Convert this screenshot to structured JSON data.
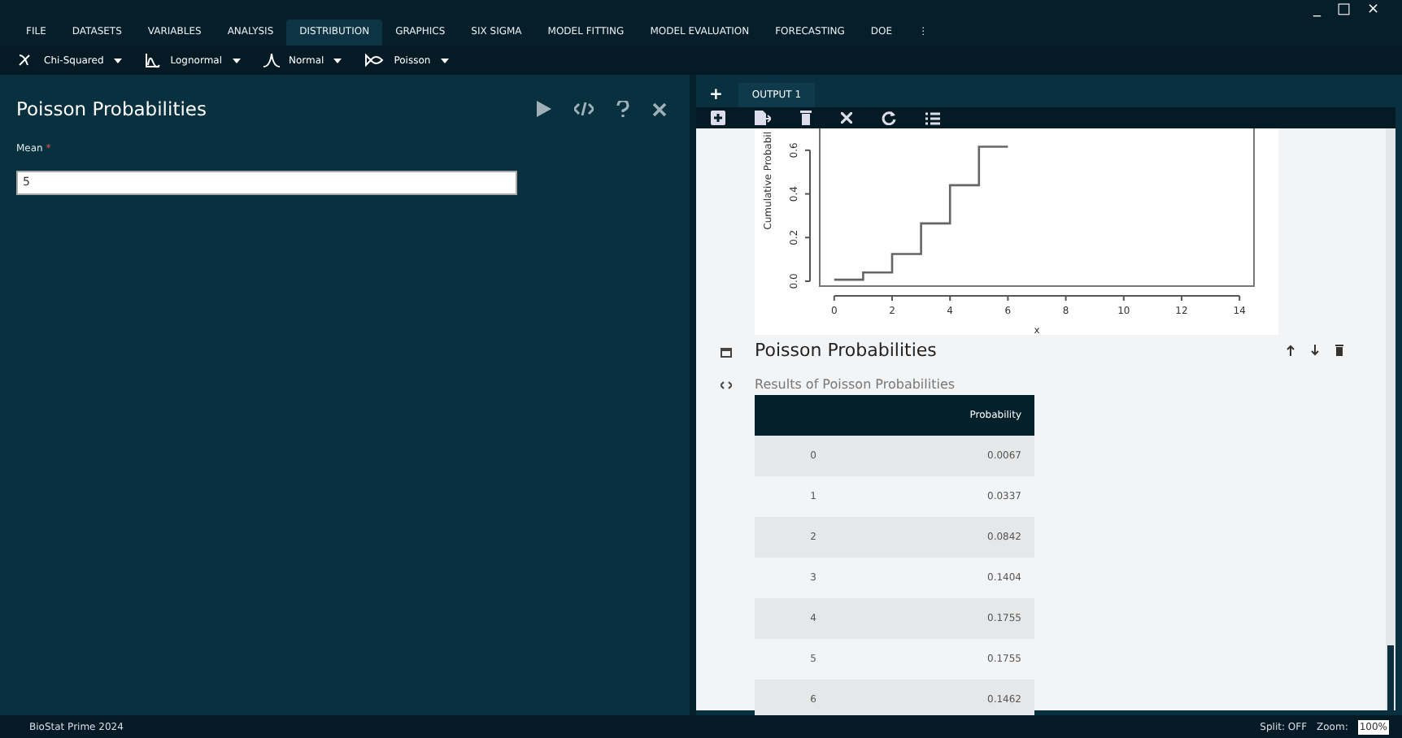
{
  "window_controls": [
    "_",
    "□",
    "×"
  ],
  "menu": [
    {
      "label": "FILE",
      "selected": false
    },
    {
      "label": "DATASETS",
      "selected": false
    },
    {
      "label": "VARIABLES",
      "selected": false
    },
    {
      "label": "ANALYSIS",
      "selected": false
    },
    {
      "label": "DISTRIBUTION",
      "selected": true
    },
    {
      "label": "GRAPHICS",
      "selected": false
    },
    {
      "label": "SIX SIGMA",
      "selected": false
    },
    {
      "label": "MODEL FITTING",
      "selected": false
    },
    {
      "label": "MODEL EVALUATION",
      "selected": false
    },
    {
      "label": "FORECASTING",
      "selected": false
    },
    {
      "label": "DOE",
      "selected": false
    },
    {
      "label": "⋮",
      "selected": false
    }
  ],
  "toolbar": [
    {
      "label": "Chi-Squared",
      "kind": "chi"
    },
    {
      "label": "Lognormal",
      "kind": "lognormal"
    },
    {
      "label": "Normal",
      "kind": "normal"
    },
    {
      "label": "Poisson",
      "kind": "poisson"
    }
  ],
  "left_panel": {
    "title": "Poisson Probabilities",
    "field": {
      "label": "Mean",
      "required_mark": "*",
      "value": "5"
    }
  },
  "output": {
    "add": "+",
    "tabs": [
      {
        "label": "OUTPUT 1",
        "selected": true
      }
    ],
    "chart_data": {
      "type": "line",
      "xlabel": "x",
      "ylabel": "Cumulative Probabil",
      "x": [
        0,
        1,
        1,
        2,
        2,
        3,
        3,
        4,
        4,
        5,
        5,
        6
      ],
      "series": [
        {
          "color": "#666666",
          "values": [
            0.007,
            0.007,
            0.04,
            0.04,
            0.125,
            0.125,
            0.265,
            0.265,
            0.44,
            0.44,
            0.616,
            0.616
          ]
        }
      ],
      "xlim": [
        -0.5,
        14.5
      ],
      "ylim": [
        0,
        0.7
      ],
      "xticks": [
        0,
        2,
        4,
        6,
        8,
        10,
        12,
        14
      ],
      "yticks": [
        {
          "value": 0,
          "label": "0.0"
        },
        {
          "value": 0.2,
          "label": "0.2"
        },
        {
          "value": 0.4,
          "label": "0.4"
        },
        {
          "value": 0.6,
          "label": "0.6"
        }
      ]
    },
    "result": {
      "title": "Poisson Probabilities",
      "subtitle": "Results of Poisson Probabilities",
      "columns": [
        "",
        "Probability"
      ],
      "rows": [
        [
          "0",
          "0.0067"
        ],
        [
          "1",
          "0.0337"
        ],
        [
          "2",
          "0.0842"
        ],
        [
          "3",
          "0.1404"
        ],
        [
          "4",
          "0.1755"
        ],
        [
          "5",
          "0.1755"
        ],
        [
          "6",
          "0.1462"
        ]
      ]
    }
  },
  "status_bar": {
    "app": "BioStat Prime 2024",
    "split": "Split: OFF",
    "zoom_label": "Zoom:",
    "zoom": "100%"
  }
}
